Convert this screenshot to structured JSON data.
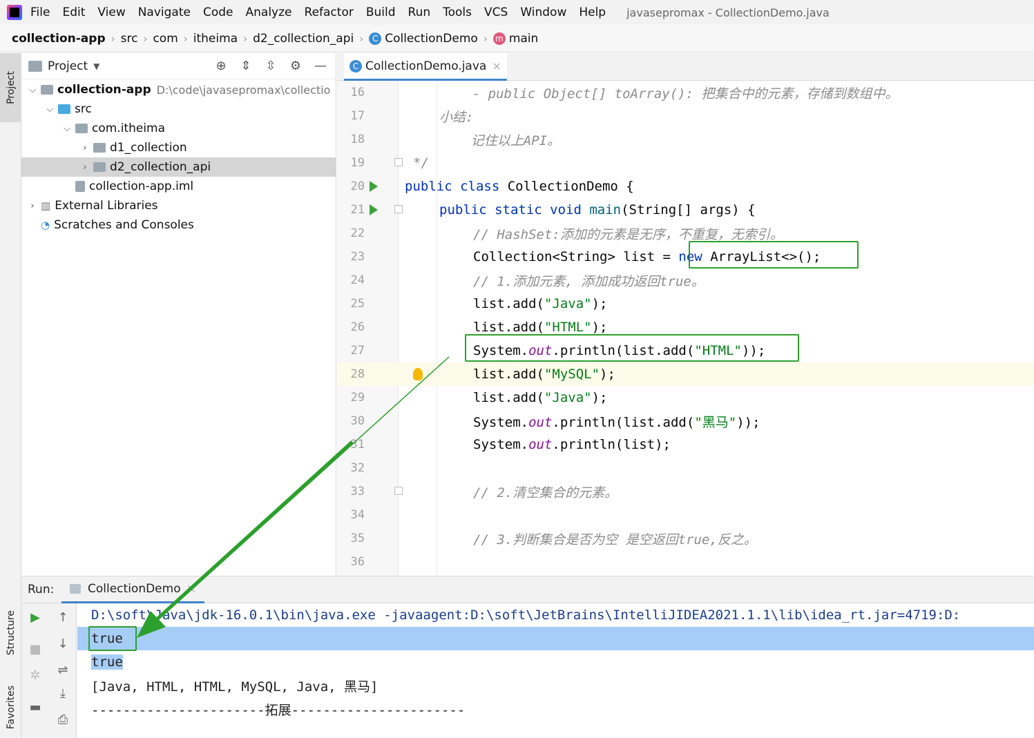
{
  "menu": {
    "items": [
      "File",
      "Edit",
      "View",
      "Navigate",
      "Code",
      "Analyze",
      "Refactor",
      "Build",
      "Run",
      "Tools",
      "VCS",
      "Window",
      "Help"
    ],
    "window_title": "javasepromax - CollectionDemo.java"
  },
  "breadcrumb": {
    "items": [
      "collection-app",
      "src",
      "com",
      "itheima",
      "d2_collection_api",
      "CollectionDemo",
      "main"
    ]
  },
  "left_stripe": {
    "project": "Project",
    "structure": "Structure",
    "favorites": "Favorites"
  },
  "project": {
    "title": "Project",
    "tree": [
      {
        "label": "collection-app",
        "path": "D:\\code\\javasepromax\\collectio"
      },
      {
        "label": "src"
      },
      {
        "label": "com.itheima"
      },
      {
        "label": "d1_collection"
      },
      {
        "label": "d2_collection_api"
      },
      {
        "label": "collection-app.iml"
      },
      {
        "label": "External Libraries"
      },
      {
        "label": "Scratches and Consoles"
      }
    ]
  },
  "editor": {
    "tab": "CollectionDemo.java",
    "lines": [
      {
        "n": "16",
        "t": "    - public Object[] toArray(): 把集合中的元素，存储到数组中。"
      },
      {
        "n": "17",
        "t": "小结:"
      },
      {
        "n": "18",
        "t": "    记住以上API。"
      },
      {
        "n": "19",
        "t": "*/"
      },
      {
        "n": "20",
        "a": "public class",
        "b": " CollectionDemo {"
      },
      {
        "n": "21",
        "a": "public static void",
        "m": " main",
        "b": "(String[] args) {"
      },
      {
        "n": "22",
        "t": "// HashSet:添加的元素是无序，不重复，无索引。"
      },
      {
        "n": "23",
        "a": "Collection<String> list = ",
        "k": "new",
        "b": " ArrayList<>();"
      },
      {
        "n": "24",
        "t": "// 1.添加元素, 添加成功返回true。"
      },
      {
        "n": "25",
        "a": "list.add(",
        "s": "\"Java\"",
        "b": ");"
      },
      {
        "n": "26",
        "a": "list.add(",
        "s": "\"HTML\"",
        "b": ");"
      },
      {
        "n": "27",
        "a": "System.",
        "f": "out",
        "b": ".println(list.add(",
        "s": "\"HTML\"",
        "c": "));"
      },
      {
        "n": "28",
        "a": "list.add(",
        "s": "\"MySQL\"",
        "b": ");"
      },
      {
        "n": "29",
        "a": "list.add(",
        "s": "\"Java\"",
        "b": ");"
      },
      {
        "n": "30",
        "a": "System.",
        "f": "out",
        "b": ".println(list.add(",
        "s": "\"黑马\"",
        "c": "));"
      },
      {
        "n": "31",
        "a": "System.",
        "f": "out",
        "b": ".println(list);"
      },
      {
        "n": "32"
      },
      {
        "n": "33",
        "t": "// 2.清空集合的元素。"
      },
      {
        "n": "34"
      },
      {
        "n": "35",
        "t": "// 3.判断集合是否为空 是空返回true,反之。"
      },
      {
        "n": "36"
      }
    ]
  },
  "run": {
    "label": "Run:",
    "tab": "CollectionDemo",
    "console": [
      "D:\\soft\\Java\\jdk-16.0.1\\bin\\java.exe -javaagent:D:\\soft\\JetBrains\\IntelliJIDEA2021.1.1\\lib\\idea_rt.jar=4719:D:",
      "true",
      "true",
      "[Java, HTML, HTML, MySQL, Java, 黑马]",
      "----------------------拓展----------------------"
    ]
  },
  "colors": {
    "annotation": "#2ca02c",
    "selection": "#a6cdf5",
    "keyword": "#0033b3",
    "string": "#067d17"
  }
}
